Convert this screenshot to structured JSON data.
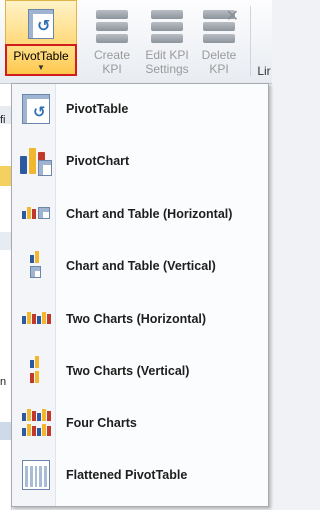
{
  "ribbon": {
    "pivottable_label": "PivotTable",
    "create_kpi_label": "Create\nKPI",
    "edit_kpi_label": "Edit KPI\nSettings",
    "delete_kpi_label": "Delete\nKPI",
    "partial_label": "Lir"
  },
  "background": {
    "frag1": "fi",
    "frag2": "n"
  },
  "menu": {
    "items": [
      {
        "label": "PivotTable",
        "icon": "pivottable-icon"
      },
      {
        "label": "PivotChart",
        "icon": "pivotchart-icon"
      },
      {
        "label": "Chart and Table (Horizontal)",
        "icon": "chart-and-table-horizontal-icon"
      },
      {
        "label": "Chart and Table (Vertical)",
        "icon": "chart-and-table-vertical-icon"
      },
      {
        "label": "Two Charts (Horizontal)",
        "icon": "two-charts-horizontal-icon"
      },
      {
        "label": "Two Charts (Vertical)",
        "icon": "two-charts-vertical-icon"
      },
      {
        "label": "Four Charts",
        "icon": "four-charts-icon"
      },
      {
        "label": "Flattened PivotTable",
        "icon": "flattened-pivottable-icon"
      }
    ]
  },
  "colors": {
    "highlight_border": "#d11d1d",
    "highlight_fill": "#ffc84d",
    "bar_blue": "#2c5aa0",
    "bar_red": "#c0392b",
    "bar_yellow": "#f1b72f"
  }
}
